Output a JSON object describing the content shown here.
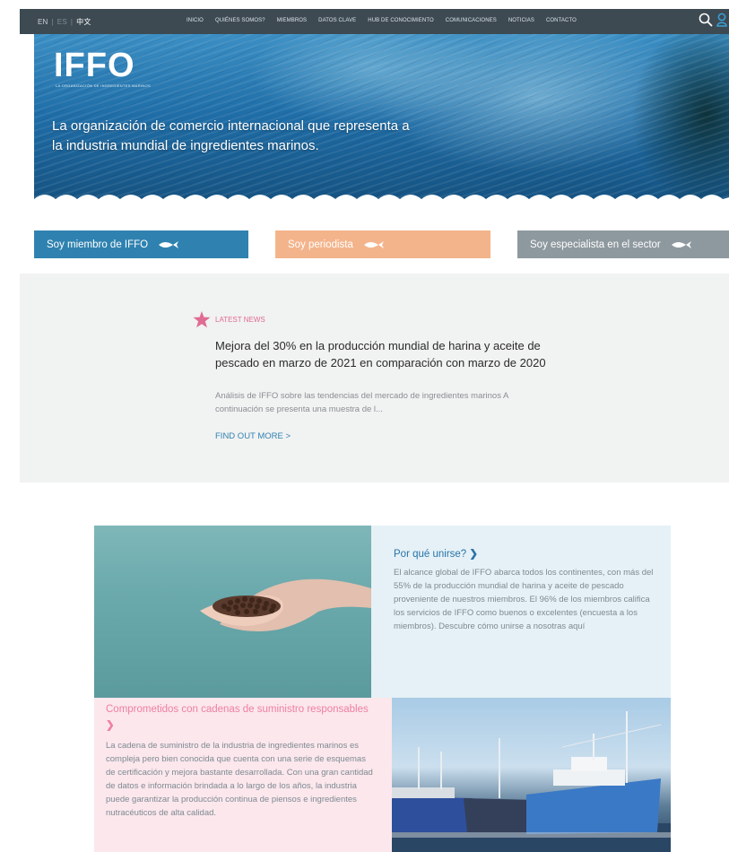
{
  "nav": {
    "languages": [
      "EN",
      "ES",
      "中文"
    ],
    "menu": [
      "INICIO",
      "QUIÉNES SOMOS?",
      "MIEMBROS",
      "DATOS CLAVE",
      "HUB DE CONOCIMIENTO",
      "COMUNICACIONES",
      "NOTICIAS",
      "CONTACTO"
    ],
    "icons": [
      "search-icon",
      "user-icon"
    ]
  },
  "hero": {
    "logo": "IFFO",
    "logo_subtitle": "LA ORGANIZACIÓN DE INGREDIENTES MARINOS",
    "tagline": "La organización de comercio internacional que representa a la industria mundial de ingredientes marinos."
  },
  "audience": {
    "member": "Soy miembro de IFFO",
    "journalist": "Soy periodista",
    "specialist": "Soy especialista en el sector"
  },
  "news": {
    "kicker": "LATEST NEWS",
    "title": "Mejora del 30% en la producción mundial de harina y aceite de pescado en marzo de 2021 en comparación con marzo de 2020",
    "excerpt": "Análisis de IFFO sobre las tendencias del mercado de ingredientes marinos A continuación se presenta una muestra de l...",
    "cta": "FIND OUT MORE >"
  },
  "cards": {
    "join": {
      "title": "Por qué unirse?",
      "body": "El alcance global de IFFO abarca todos los continentes, con más del 55% de la producción mundial de harina y aceite de pescado proveniente de nuestros miembros. El 96% de los miembros califica los servicios de IFFO como buenos o excelentes (encuesta a los miembros). Descubre cómo unirse a nosotras aquí"
    },
    "supply": {
      "title": "Comprometidos con cadenas de suministro responsables",
      "body": "La cadena de suministro de la industria de ingredientes marinos es compleja pero bien conocida que cuenta con una serie de esquemas de certificación y mejora bastante desarrollada. Con una gran cantidad de datos e información brindada a lo largo de los años, la industria puede garantizar la producción continua de piensos e ingredientes nutracéuticos de alta calidad."
    }
  },
  "colors": {
    "nav_bg": "#3d4a52",
    "member_blue": "#2f82b0",
    "journalist_peach": "#f4b48b",
    "specialist_gray": "#8e999f",
    "news_pink": "#e06b93",
    "supply_pink": "#f07fa1"
  }
}
